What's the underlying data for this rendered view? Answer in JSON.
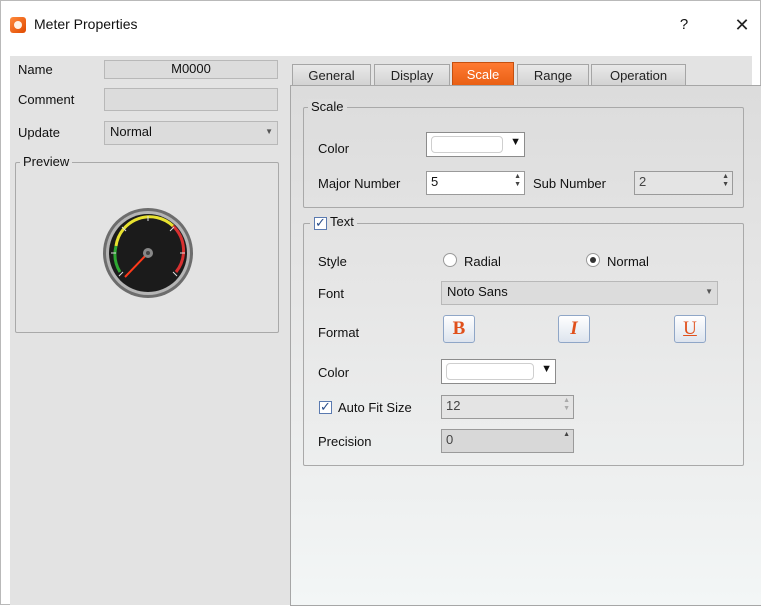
{
  "window": {
    "title": "Meter Properties",
    "help_label": "?",
    "close_label": "✕"
  },
  "left": {
    "name_label": "Name",
    "name_value": "M0000",
    "comment_label": "Comment",
    "comment_value": "",
    "update_label": "Update",
    "update_value": "Normal",
    "preview_label": "Preview"
  },
  "tabs": [
    {
      "label": "General"
    },
    {
      "label": "Display"
    },
    {
      "label": "Scale"
    },
    {
      "label": "Range"
    },
    {
      "label": "Operation"
    }
  ],
  "active_tab": "Scale",
  "scale_group": {
    "title": "Scale",
    "color_label": "Color",
    "color_value": "#ffffff",
    "major_label": "Major Number",
    "major_value": "5",
    "sub_label": "Sub Number",
    "sub_value": "2"
  },
  "text_group": {
    "title": "Text",
    "enabled": true,
    "style_label": "Style",
    "style_options": [
      {
        "label": "Radial",
        "selected": false
      },
      {
        "label": "Normal",
        "selected": true
      }
    ],
    "font_label": "Font",
    "font_value": "Noto Sans",
    "format_label": "Format",
    "format_buttons": [
      {
        "label": "B",
        "icon": "bold-icon"
      },
      {
        "label": "I",
        "icon": "italic-icon"
      },
      {
        "label": "U",
        "icon": "underline-icon"
      }
    ],
    "color_label": "Color",
    "color_value": "#ffffff",
    "autofit_label": "Auto Fit Size",
    "autofit_checked": true,
    "autofit_value": "12",
    "precision_label": "Precision",
    "precision_value": "0"
  },
  "colors": {
    "accent": "#f26a1b",
    "background": "#e3e3e3"
  }
}
